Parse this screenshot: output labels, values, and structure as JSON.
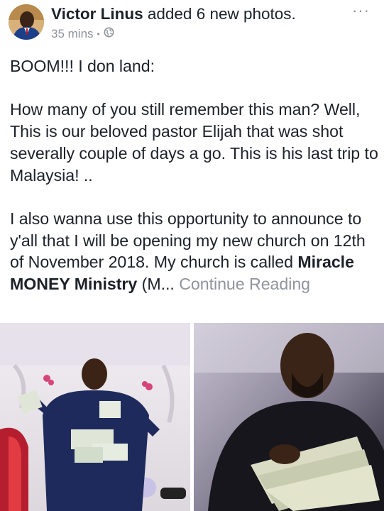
{
  "post": {
    "author": "Victor Linus",
    "action": "added 6 new photos.",
    "time": "35 mins",
    "separator": "•",
    "more_label": "···",
    "line1": "BOOM!!! I don land:",
    "para2": "How many of you still remember this man? Well, This is our beloved pastor Elijah that was shot severally couple of days a go. This is his last trip to Malaysia!  ..",
    "para3_start": "I also wanna use this opportunity to announce to y'all that I will be opening my new church on 12th of November 2018. My church is called ",
    "para3_bold": "Miracle MONEY Ministry",
    "para3_end": " (M...",
    "continue_label": "Continue Reading"
  },
  "colors": {
    "text": "#1d2129",
    "muted": "#90949c",
    "background": "#ffffff"
  },
  "icons": {
    "privacy": "globe-icon",
    "more": "more-options-icon"
  }
}
